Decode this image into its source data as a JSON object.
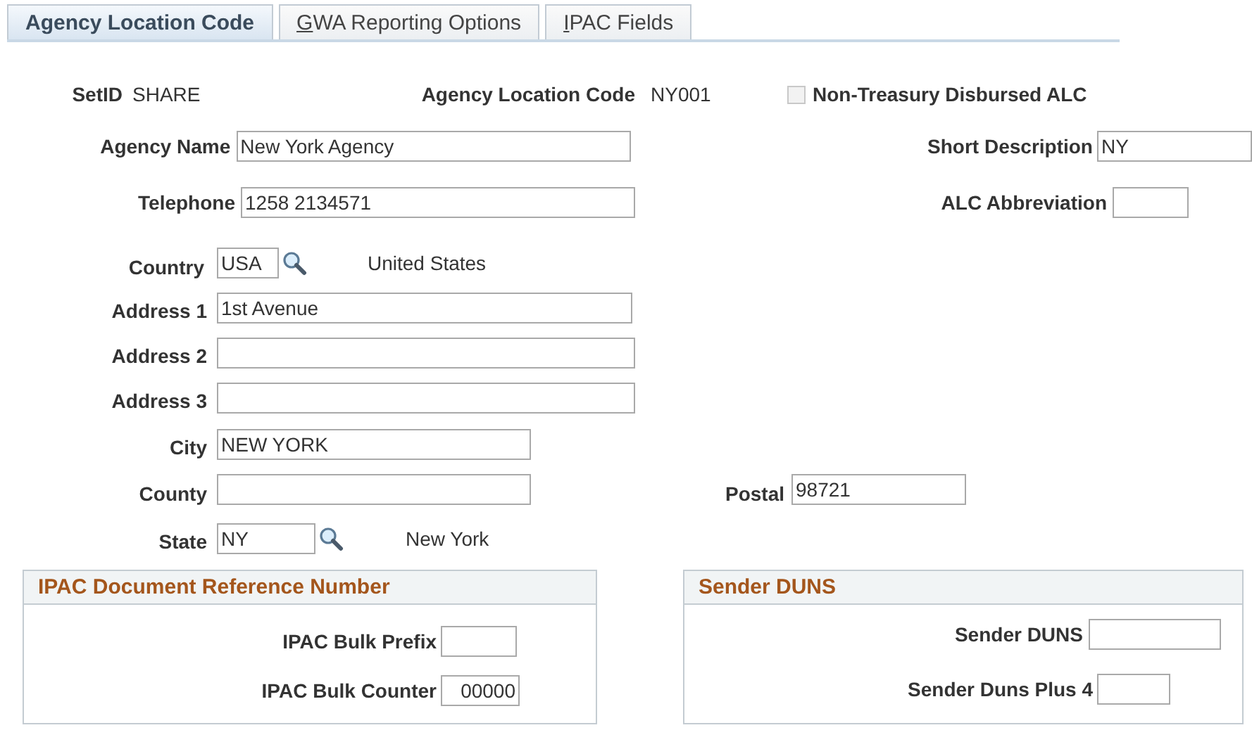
{
  "tabs": [
    {
      "label": "Agency Location Code",
      "selected": true,
      "access_key": false
    },
    {
      "label": "GWA Reporting Options",
      "selected": false,
      "access_key": true
    },
    {
      "label": "IPAC Fields",
      "selected": false,
      "access_key": true
    }
  ],
  "setid": {
    "label": "SetID",
    "value": "SHARE"
  },
  "agency_location_code": {
    "label": "Agency Location Code",
    "value": "NY001"
  },
  "non_treasury": {
    "label": "Non-Treasury Disbursed ALC",
    "checked": false
  },
  "agency_name": {
    "label": "Agency Name",
    "value": "New York Agency"
  },
  "short_description": {
    "label": "Short Description",
    "value": "NY"
  },
  "telephone": {
    "label": "Telephone",
    "value": "1258 2134571"
  },
  "alc_abbreviation": {
    "label": "ALC Abbreviation"
  },
  "country": {
    "label": "Country",
    "value": "USA",
    "description": "United States"
  },
  "address_1": {
    "label": "Address 1",
    "value": "1st Avenue"
  },
  "address_2": {
    "label": "Address 2"
  },
  "address_3": {
    "label": "Address 3"
  },
  "city": {
    "label": "City",
    "value": "NEW YORK"
  },
  "county": {
    "label": "County"
  },
  "postal": {
    "label": "Postal",
    "value": "98721"
  },
  "state": {
    "label": "State",
    "value": "NY",
    "description": "New York"
  },
  "ipac_group": {
    "title": "IPAC Document Reference Number",
    "bulk_prefix": {
      "label": "IPAC Bulk Prefix"
    },
    "bulk_counter": {
      "label": "IPAC Bulk Counter",
      "value": "00000"
    }
  },
  "sender_group": {
    "title": "Sender DUNS",
    "sender_duns": {
      "label": "Sender DUNS"
    },
    "sender_duns_plus_4": {
      "label": "Sender Duns Plus 4"
    }
  }
}
